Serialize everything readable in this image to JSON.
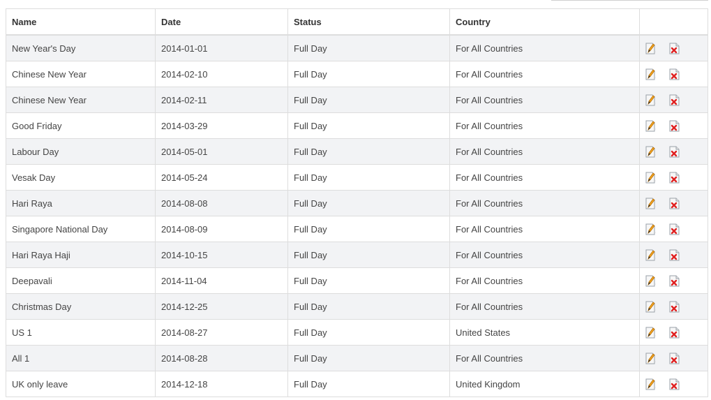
{
  "table": {
    "columns": [
      "Name",
      "Date",
      "Status",
      "Country",
      ""
    ],
    "rows": [
      {
        "name": "New Year's Day",
        "date": "2014-01-01",
        "status": "Full Day",
        "country": "For All Countries"
      },
      {
        "name": "Chinese New Year",
        "date": "2014-02-10",
        "status": "Full Day",
        "country": "For All Countries"
      },
      {
        "name": "Chinese New Year",
        "date": "2014-02-11",
        "status": "Full Day",
        "country": "For All Countries"
      },
      {
        "name": "Good Friday",
        "date": "2014-03-29",
        "status": "Full Day",
        "country": "For All Countries"
      },
      {
        "name": "Labour Day",
        "date": "2014-05-01",
        "status": "Full Day",
        "country": "For All Countries"
      },
      {
        "name": "Vesak Day",
        "date": "2014-05-24",
        "status": "Full Day",
        "country": "For All Countries"
      },
      {
        "name": "Hari Raya",
        "date": "2014-08-08",
        "status": "Full Day",
        "country": "For All Countries"
      },
      {
        "name": "Singapore National Day",
        "date": "2014-08-09",
        "status": "Full Day",
        "country": "For All Countries"
      },
      {
        "name": "Hari Raya Haji",
        "date": "2014-10-15",
        "status": "Full Day",
        "country": "For All Countries"
      },
      {
        "name": "Deepavali",
        "date": "2014-11-04",
        "status": "Full Day",
        "country": "For All Countries"
      },
      {
        "name": "Christmas Day",
        "date": "2014-12-25",
        "status": "Full Day",
        "country": "For All Countries"
      },
      {
        "name": "US 1",
        "date": "2014-08-27",
        "status": "Full Day",
        "country": "United States"
      },
      {
        "name": "All 1",
        "date": "2014-08-28",
        "status": "Full Day",
        "country": "For All Countries"
      },
      {
        "name": "UK only leave",
        "date": "2014-12-18",
        "status": "Full Day",
        "country": "United Kingdom"
      }
    ],
    "row_actions": [
      {
        "name": "edit",
        "icon": "edit-pencil-icon"
      },
      {
        "name": "delete",
        "icon": "delete-document-icon"
      }
    ]
  },
  "colors": {
    "stripe": "#f2f3f5",
    "border": "#dddddd",
    "edit_accent": "#f5a623",
    "delete_accent": "#e02020"
  }
}
